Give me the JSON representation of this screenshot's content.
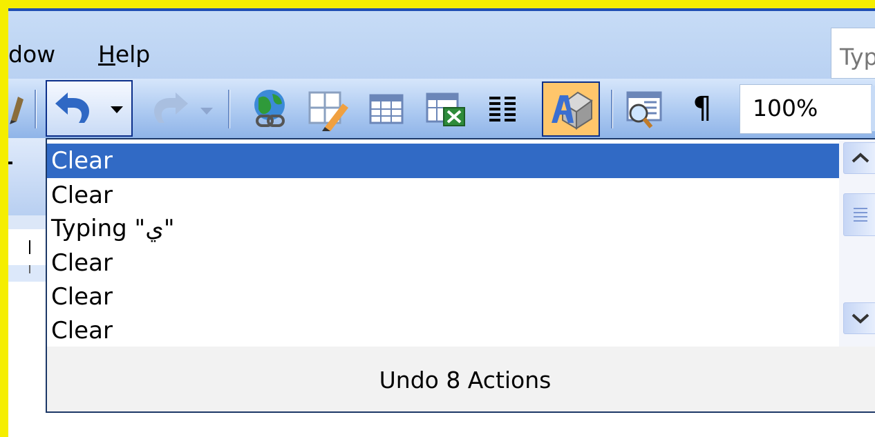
{
  "menubar": {
    "window_label": "dow",
    "help_label": "Help",
    "help_mnemonic": "H",
    "help_rest": "elp",
    "ask_placeholder": "Typ"
  },
  "toolbar": {
    "zoom_value": "100%",
    "pilcrow": "¶",
    "icons": [
      "pen-icon",
      "undo-icon",
      "redo-icon",
      "hyperlink-icon",
      "tables-borders-icon",
      "insert-table-icon",
      "insert-excel-icon",
      "columns-icon",
      "drawing-icon",
      "document-map-icon",
      "show-hide-icon"
    ]
  },
  "undo_list": {
    "items": [
      {
        "label": "Clear",
        "selected": true
      },
      {
        "label": "Clear",
        "selected": false
      },
      {
        "label": "Typing \"ي\"",
        "selected": false
      },
      {
        "label": "Clear",
        "selected": false
      },
      {
        "label": "Clear",
        "selected": false
      },
      {
        "label": "Clear",
        "selected": false
      }
    ],
    "footer": "Undo 8 Actions"
  },
  "colors": {
    "frame": "#f5ee00",
    "selection": "#316ac5",
    "menubar": "#c7dcf6",
    "highlight": "#ffc66b"
  }
}
